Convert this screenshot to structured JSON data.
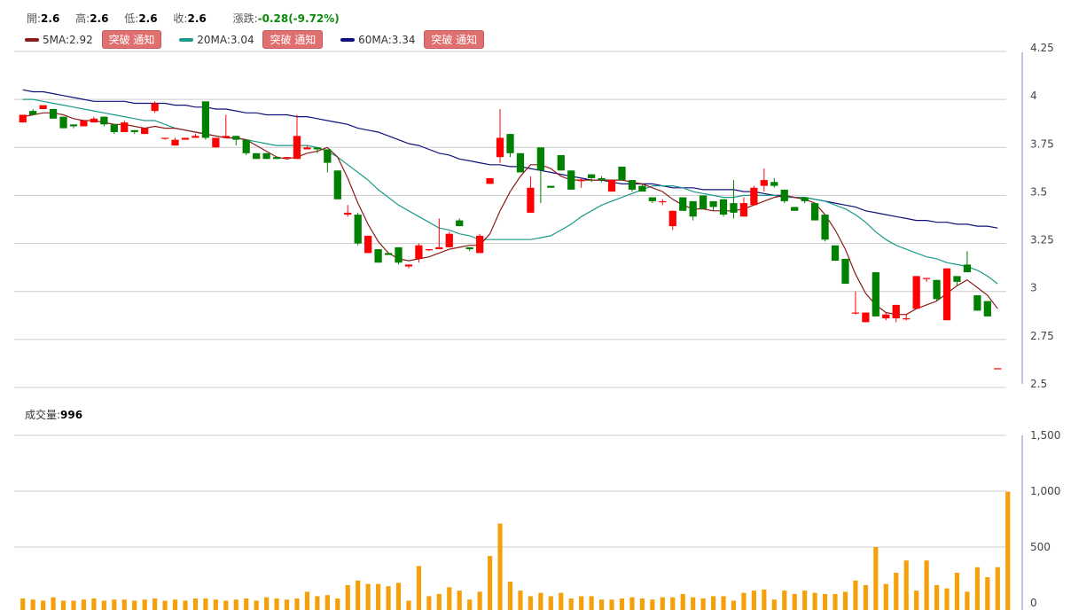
{
  "ohlc": {
    "open_label": "開:",
    "open": "2.6",
    "high_label": "高:",
    "high": "2.6",
    "low_label": "低:",
    "low": "2.6",
    "close_label": "收:",
    "close": "2.6",
    "change_label": "漲跌:",
    "change": "-0.28(-9.72%)"
  },
  "ma_legend": [
    {
      "label": "5MA:2.92",
      "color": "#8b1a1a",
      "button": "突破 通知"
    },
    {
      "label": "20MA:3.04",
      "color": "#1a9a8a",
      "button": "突破 通知"
    },
    {
      "label": "60MA:3.34",
      "color": "#10107a",
      "button": "突破 通知"
    }
  ],
  "volume": {
    "label": "成交量:",
    "value": "996"
  },
  "colors": {
    "up": "#ff0000",
    "down": "#008000",
    "volume": "#f5a00a",
    "grid": "#cccccc"
  },
  "chart_data": [
    {
      "type": "candlestick",
      "title": "",
      "ylim": [
        2.5,
        4.25
      ],
      "yticks": [
        "4.25",
        "4",
        "3.75",
        "3.5",
        "3.25",
        "3",
        "2.75",
        "2.5"
      ],
      "ytick_values": [
        4.25,
        4,
        3.75,
        3.5,
        3.25,
        3,
        2.75,
        2.5
      ],
      "grid": true,
      "candles": [
        [
          3.88,
          3.92,
          3.88,
          3.92
        ],
        [
          3.94,
          3.95,
          3.92,
          3.92
        ],
        [
          3.95,
          3.97,
          3.95,
          3.97
        ],
        [
          3.95,
          3.95,
          3.9,
          3.9
        ],
        [
          3.91,
          3.91,
          3.85,
          3.85
        ],
        [
          3.87,
          3.87,
          3.85,
          3.86
        ],
        [
          3.86,
          3.89,
          3.86,
          3.89
        ],
        [
          3.88,
          3.91,
          3.88,
          3.9
        ],
        [
          3.91,
          3.91,
          3.86,
          3.87
        ],
        [
          3.87,
          3.87,
          3.82,
          3.83
        ],
        [
          3.83,
          3.89,
          3.83,
          3.88
        ],
        [
          3.84,
          3.84,
          3.82,
          3.83
        ],
        [
          3.82,
          3.85,
          3.82,
          3.85
        ],
        [
          3.94,
          3.99,
          3.93,
          3.98
        ],
        [
          3.8,
          3.8,
          3.79,
          3.8
        ],
        [
          3.76,
          3.8,
          3.76,
          3.79
        ],
        [
          3.79,
          3.8,
          3.79,
          3.8
        ],
        [
          3.8,
          3.82,
          3.8,
          3.81
        ],
        [
          3.99,
          3.99,
          3.79,
          3.8
        ],
        [
          3.75,
          3.8,
          3.75,
          3.8
        ],
        [
          3.8,
          3.92,
          3.8,
          3.81
        ],
        [
          3.81,
          3.81,
          3.76,
          3.79
        ],
        [
          3.79,
          3.79,
          3.71,
          3.72
        ],
        [
          3.72,
          3.72,
          3.69,
          3.69
        ],
        [
          3.72,
          3.72,
          3.69,
          3.69
        ],
        [
          3.7,
          3.7,
          3.69,
          3.69
        ],
        [
          3.7,
          3.7,
          3.69,
          3.7
        ],
        [
          3.69,
          3.92,
          3.69,
          3.81
        ],
        [
          3.74,
          3.76,
          3.74,
          3.75
        ],
        [
          3.75,
          3.75,
          3.72,
          3.74
        ],
        [
          3.74,
          3.74,
          3.62,
          3.67
        ],
        [
          3.63,
          3.63,
          3.48,
          3.48
        ],
        [
          3.4,
          3.45,
          3.39,
          3.41
        ],
        [
          3.4,
          3.41,
          3.24,
          3.25
        ],
        [
          3.2,
          3.29,
          3.2,
          3.29
        ],
        [
          3.22,
          3.22,
          3.15,
          3.15
        ],
        [
          3.2,
          3.2,
          3.19,
          3.19
        ],
        [
          3.23,
          3.23,
          3.14,
          3.15
        ],
        [
          3.13,
          3.14,
          3.12,
          3.14
        ],
        [
          3.17,
          3.25,
          3.15,
          3.24
        ],
        [
          3.22,
          3.22,
          3.21,
          3.22
        ],
        [
          3.22,
          3.38,
          3.22,
          3.23
        ],
        [
          3.23,
          3.31,
          3.23,
          3.3
        ],
        [
          3.37,
          3.38,
          3.34,
          3.34
        ],
        [
          3.23,
          3.23,
          3.21,
          3.22
        ],
        [
          3.2,
          3.3,
          3.2,
          3.29
        ],
        [
          3.56,
          3.59,
          3.56,
          3.59
        ],
        [
          3.7,
          3.95,
          3.67,
          3.8
        ],
        [
          3.82,
          3.82,
          3.7,
          3.72
        ],
        [
          3.72,
          3.72,
          3.62,
          3.62
        ],
        [
          3.41,
          3.6,
          3.41,
          3.54
        ],
        [
          3.75,
          3.75,
          3.46,
          3.63
        ],
        [
          3.55,
          3.55,
          3.54,
          3.54
        ],
        [
          3.71,
          3.71,
          3.63,
          3.63
        ],
        [
          3.63,
          3.63,
          3.53,
          3.53
        ],
        [
          3.58,
          3.59,
          3.54,
          3.58
        ],
        [
          3.61,
          3.61,
          3.57,
          3.59
        ],
        [
          3.59,
          3.6,
          3.57,
          3.58
        ],
        [
          3.52,
          3.58,
          3.52,
          3.58
        ],
        [
          3.65,
          3.65,
          3.58,
          3.58
        ],
        [
          3.58,
          3.58,
          3.52,
          3.53
        ],
        [
          3.55,
          3.56,
          3.52,
          3.52
        ],
        [
          3.49,
          3.49,
          3.46,
          3.47
        ],
        [
          3.47,
          3.48,
          3.45,
          3.47
        ],
        [
          3.34,
          3.42,
          3.32,
          3.42
        ],
        [
          3.49,
          3.49,
          3.42,
          3.42
        ],
        [
          3.47,
          3.47,
          3.37,
          3.39
        ],
        [
          3.5,
          3.5,
          3.43,
          3.43
        ],
        [
          3.47,
          3.47,
          3.42,
          3.44
        ],
        [
          3.48,
          3.48,
          3.39,
          3.4
        ],
        [
          3.46,
          3.58,
          3.38,
          3.41
        ],
        [
          3.39,
          3.49,
          3.39,
          3.46
        ],
        [
          3.45,
          3.55,
          3.45,
          3.54
        ],
        [
          3.55,
          3.64,
          3.52,
          3.58
        ],
        [
          3.57,
          3.59,
          3.54,
          3.55
        ],
        [
          3.53,
          3.53,
          3.46,
          3.47
        ],
        [
          3.44,
          3.44,
          3.42,
          3.42
        ],
        [
          3.49,
          3.49,
          3.46,
          3.47
        ],
        [
          3.46,
          3.46,
          3.37,
          3.37
        ],
        [
          3.4,
          3.4,
          3.26,
          3.27
        ],
        [
          3.24,
          3.24,
          3.16,
          3.16
        ],
        [
          3.17,
          3.17,
          3.04,
          3.04
        ],
        [
          2.89,
          3.0,
          2.88,
          2.89
        ],
        [
          2.84,
          2.89,
          2.84,
          2.89
        ],
        [
          3.1,
          3.1,
          2.87,
          2.87
        ],
        [
          2.86,
          2.89,
          2.85,
          2.88
        ],
        [
          2.86,
          2.93,
          2.84,
          2.93
        ],
        [
          2.86,
          2.88,
          2.85,
          2.86
        ],
        [
          2.91,
          3.08,
          2.91,
          3.08
        ],
        [
          3.07,
          3.07,
          3.05,
          3.07
        ],
        [
          3.06,
          3.06,
          2.95,
          2.96
        ],
        [
          2.85,
          3.12,
          2.85,
          3.12
        ],
        [
          3.08,
          3.08,
          3.03,
          3.05
        ],
        [
          3.14,
          3.21,
          3.1,
          3.1
        ],
        [
          2.98,
          2.98,
          2.9,
          2.9
        ],
        [
          2.95,
          2.95,
          2.87,
          2.87
        ],
        [
          2.6,
          2.6,
          2.6,
          2.6
        ]
      ],
      "ma5": [
        3.91,
        3.92,
        3.93,
        3.93,
        3.92,
        3.9,
        3.89,
        3.89,
        3.88,
        3.87,
        3.87,
        3.86,
        3.85,
        3.86,
        3.85,
        3.85,
        3.84,
        3.83,
        3.82,
        3.81,
        3.8,
        3.8,
        3.79,
        3.76,
        3.73,
        3.7,
        3.69,
        3.7,
        3.72,
        3.73,
        3.75,
        3.7,
        3.59,
        3.46,
        3.35,
        3.26,
        3.2,
        3.17,
        3.16,
        3.17,
        3.18,
        3.2,
        3.22,
        3.23,
        3.24,
        3.24,
        3.3,
        3.42,
        3.52,
        3.6,
        3.66,
        3.66,
        3.64,
        3.6,
        3.58,
        3.58,
        3.58,
        3.58,
        3.58,
        3.58,
        3.57,
        3.56,
        3.54,
        3.52,
        3.48,
        3.45,
        3.43,
        3.43,
        3.42,
        3.42,
        3.42,
        3.43,
        3.45,
        3.47,
        3.49,
        3.5,
        3.49,
        3.48,
        3.46,
        3.4,
        3.32,
        3.22,
        3.09,
        2.99,
        2.93,
        2.89,
        2.88,
        2.88,
        2.91,
        2.93,
        2.95,
        2.99,
        3.03,
        3.06,
        3.02,
        2.98,
        2.91
      ],
      "ma20": [
        4.0,
        4.0,
        3.99,
        3.98,
        3.97,
        3.96,
        3.95,
        3.94,
        3.93,
        3.92,
        3.91,
        3.9,
        3.89,
        3.89,
        3.87,
        3.85,
        3.84,
        3.83,
        3.82,
        3.81,
        3.8,
        3.8,
        3.79,
        3.78,
        3.77,
        3.76,
        3.76,
        3.76,
        3.76,
        3.75,
        3.73,
        3.7,
        3.66,
        3.62,
        3.58,
        3.53,
        3.49,
        3.45,
        3.42,
        3.39,
        3.36,
        3.33,
        3.32,
        3.3,
        3.29,
        3.27,
        3.27,
        3.27,
        3.27,
        3.27,
        3.27,
        3.28,
        3.29,
        3.32,
        3.35,
        3.39,
        3.42,
        3.45,
        3.47,
        3.49,
        3.51,
        3.53,
        3.55,
        3.55,
        3.55,
        3.54,
        3.52,
        3.51,
        3.5,
        3.49,
        3.49,
        3.5,
        3.5,
        3.5,
        3.5,
        3.49,
        3.49,
        3.49,
        3.48,
        3.47,
        3.45,
        3.43,
        3.4,
        3.36,
        3.31,
        3.27,
        3.24,
        3.22,
        3.2,
        3.18,
        3.17,
        3.15,
        3.14,
        3.13,
        3.11,
        3.08,
        3.04
      ],
      "ma60": [
        4.05,
        4.04,
        4.04,
        4.03,
        4.02,
        4.01,
        4.0,
        3.99,
        3.99,
        3.99,
        3.99,
        3.98,
        3.98,
        3.98,
        3.98,
        3.97,
        3.97,
        3.96,
        3.96,
        3.95,
        3.95,
        3.94,
        3.93,
        3.93,
        3.92,
        3.92,
        3.92,
        3.91,
        3.91,
        3.9,
        3.89,
        3.88,
        3.87,
        3.85,
        3.84,
        3.83,
        3.81,
        3.79,
        3.77,
        3.76,
        3.74,
        3.72,
        3.71,
        3.69,
        3.68,
        3.67,
        3.66,
        3.66,
        3.65,
        3.65,
        3.64,
        3.63,
        3.62,
        3.61,
        3.6,
        3.59,
        3.58,
        3.58,
        3.57,
        3.56,
        3.56,
        3.56,
        3.56,
        3.55,
        3.54,
        3.54,
        3.54,
        3.53,
        3.53,
        3.53,
        3.53,
        3.52,
        3.52,
        3.51,
        3.5,
        3.5,
        3.49,
        3.49,
        3.48,
        3.47,
        3.46,
        3.45,
        3.44,
        3.42,
        3.41,
        3.4,
        3.39,
        3.38,
        3.37,
        3.37,
        3.36,
        3.36,
        3.35,
        3.35,
        3.34,
        3.34,
        3.33
      ]
    },
    {
      "type": "bar",
      "title": "",
      "ylim": [
        0,
        1500
      ],
      "yticks": [
        "1,500",
        "1,000",
        "500",
        "0"
      ],
      "ytick_values": [
        1500,
        1000,
        500,
        0
      ],
      "grid": true,
      "values": [
        40,
        30,
        20,
        50,
        20,
        20,
        30,
        40,
        20,
        30,
        30,
        20,
        30,
        40,
        20,
        30,
        20,
        40,
        40,
        30,
        20,
        30,
        40,
        20,
        50,
        40,
        30,
        40,
        100,
        60,
        70,
        40,
        160,
        200,
        170,
        170,
        150,
        180,
        20,
        330,
        60,
        80,
        140,
        110,
        30,
        100,
        420,
        710,
        190,
        110,
        60,
        90,
        60,
        90,
        40,
        60,
        60,
        30,
        30,
        40,
        50,
        40,
        30,
        50,
        50,
        80,
        50,
        40,
        60,
        60,
        20,
        90,
        110,
        120,
        30,
        110,
        80,
        110,
        90,
        80,
        80,
        100,
        200,
        160,
        500,
        170,
        270,
        380,
        110,
        380,
        160,
        130,
        270,
        100,
        320,
        230,
        320,
        996
      ]
    }
  ]
}
